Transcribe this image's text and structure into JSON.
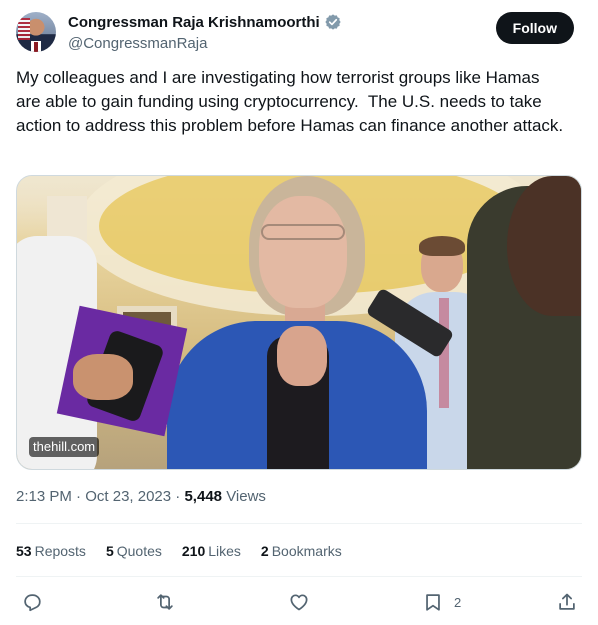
{
  "author": {
    "display_name": "Congressman Raja Krishnamoorthi",
    "handle": "@CongressmanRaja",
    "verified_color": "#829aab"
  },
  "follow_label": "Follow",
  "tweet_text": "My colleagues and I are investigating how terrorist groups like Hamas are able to gain funding using cryptocurrency.  The U.S. needs to take action to address this problem before Hamas can finance another attack.",
  "media": {
    "source_label": "thehill.com"
  },
  "meta": {
    "time": "2:13 PM",
    "sep1": " · ",
    "date": "Oct 23, 2023",
    "sep2": " · ",
    "views_count": "5,448",
    "views_label": "Views"
  },
  "stats": {
    "reposts_count": "53",
    "reposts_label": "Reposts",
    "quotes_count": "5",
    "quotes_label": "Quotes",
    "likes_count": "210",
    "likes_label": "Likes",
    "bookmarks_count": "2",
    "bookmarks_label": "Bookmarks"
  },
  "actions": {
    "reply_icon": "reply-icon",
    "repost_icon": "repost-icon",
    "like_icon": "heart-icon",
    "bookmark_icon": "bookmark-icon",
    "bookmark_count": "2",
    "share_icon": "share-icon"
  }
}
